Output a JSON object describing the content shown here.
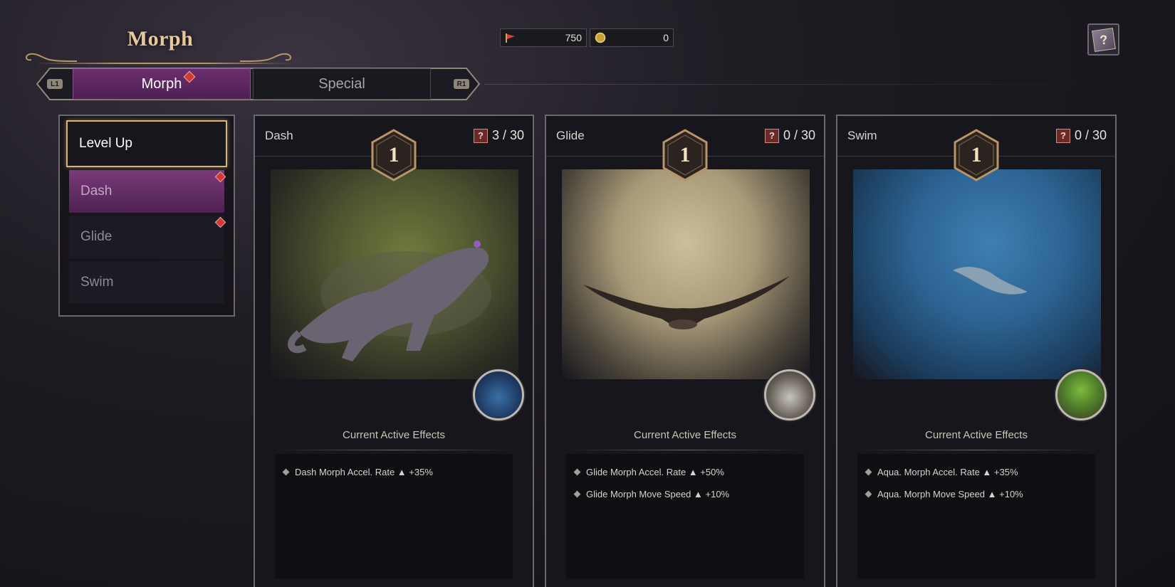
{
  "header": {
    "title": "Morph",
    "currencies": [
      {
        "icon": "red-flag-icon",
        "value": "750"
      },
      {
        "icon": "gold-coin-icon",
        "value": "0"
      }
    ]
  },
  "tabs": {
    "left_hint": "L1",
    "right_hint": "R1",
    "items": [
      {
        "label": "Morph",
        "active": true,
        "badge": true
      },
      {
        "label": "Special",
        "active": false,
        "badge": false
      }
    ]
  },
  "menu": {
    "items": [
      {
        "label": "Level Up"
      },
      {
        "label": "Dash"
      },
      {
        "label": "Glide"
      },
      {
        "label": "Swim"
      }
    ]
  },
  "cards": [
    {
      "name": "Dash",
      "count": "3 / 30",
      "level": "1",
      "effects_title": "Current Active Effects",
      "effects": [
        "Dash Morph Accel. Rate ▲ +35%"
      ]
    },
    {
      "name": "Glide",
      "count": "0 / 30",
      "level": "1",
      "effects_title": "Current Active Effects",
      "effects": [
        "Glide Morph Accel. Rate ▲ +50%",
        "Glide Morph Move Speed ▲ +10%"
      ]
    },
    {
      "name": "Swim",
      "count": "0 / 30",
      "level": "1",
      "effects_title": "Current Active Effects",
      "effects": [
        "Aqua. Morph Accel. Rate ▲ +35%",
        "Aqua. Morph Move Speed ▲ +10%"
      ]
    }
  ],
  "colors": {
    "accent_purple": "#6b2e6e",
    "gold_trim": "#d8b577",
    "badge_red": "#d23a35"
  }
}
